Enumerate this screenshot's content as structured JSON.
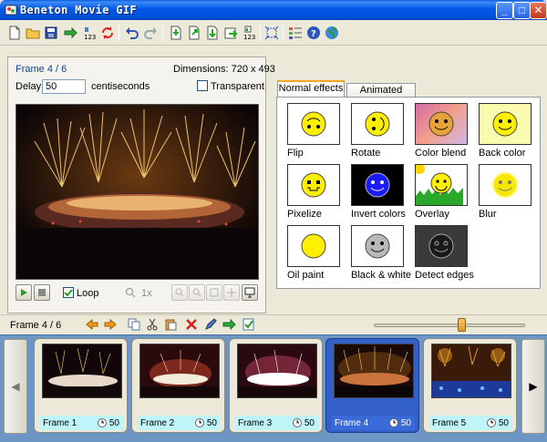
{
  "window": {
    "title": "Beneton Movie GIF",
    "minimize": "_",
    "maximize": "□",
    "close": "✕"
  },
  "toolbar": {
    "icons": [
      "new-icon",
      "open-icon",
      "save-icon",
      "export-numbered-icon",
      "numbered-123-icon",
      "refresh-icon",
      "undo-icon",
      "redo-icon",
      "insert-frame-icon",
      "export-frame-icon",
      "import-frame-icon",
      "save-frame-icon",
      "numbered-frames-icon",
      "crop-icon",
      "frame-list-icon",
      "help-icon",
      "web-icon"
    ]
  },
  "preview": {
    "frame_label": "Frame 4 / 6",
    "dimensions": "Dimensions: 720 x 493",
    "delay_label": "Delay",
    "delay_value": "50",
    "delay_unit": "centiseconds",
    "transparent_label": "Transparent",
    "transparent_checked": false,
    "loop_label": "Loop",
    "loop_checked": true,
    "zoom": "1x"
  },
  "effects": {
    "tabs": [
      "Normal effects",
      "Animated effects"
    ],
    "active_tab": "Normal effects",
    "items": [
      {
        "label": "Flip"
      },
      {
        "label": "Rotate"
      },
      {
        "label": "Color blend"
      },
      {
        "label": "Back color"
      },
      {
        "label": "Pixelize"
      },
      {
        "label": "Invert colors"
      },
      {
        "label": "Overlay"
      },
      {
        "label": "Blur"
      },
      {
        "label": "Oil paint"
      },
      {
        "label": "Black & white"
      },
      {
        "label": "Detect edges"
      }
    ]
  },
  "framebar": {
    "label": "Frame 4 / 6",
    "zoom_level": 0.58
  },
  "frames": [
    {
      "label": "Frame 1",
      "delay": "50",
      "selected": false
    },
    {
      "label": "Frame 2",
      "delay": "50",
      "selected": false
    },
    {
      "label": "Frame 3",
      "delay": "50",
      "selected": false
    },
    {
      "label": "Frame 4",
      "delay": "50",
      "selected": true
    },
    {
      "label": "Frame 5",
      "delay": "50",
      "selected": false
    }
  ],
  "colors": {
    "titlebar": "#0058e6",
    "selection": "#3360c8",
    "strip_bg": "#6d96c5",
    "accent_tab": "#f5a623"
  }
}
